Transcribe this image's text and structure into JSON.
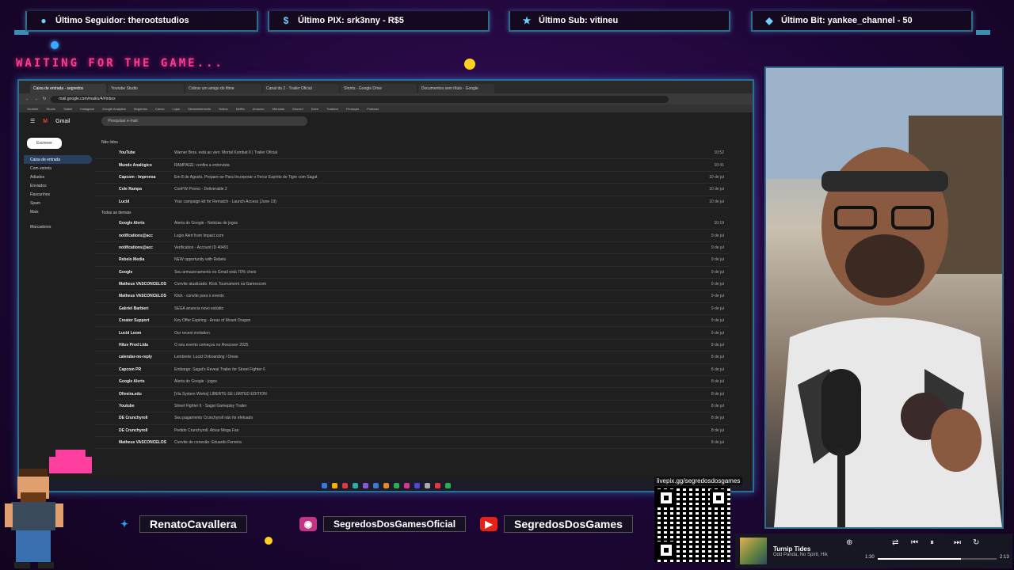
{
  "alerts": [
    {
      "icon": "user-icon",
      "label": "Último Seguidor: therootstudios"
    },
    {
      "icon": "dollar-icon",
      "label": "Último PIX: srk3nny - R$5"
    },
    {
      "icon": "star-icon",
      "label": "Último Sub: vitineu"
    },
    {
      "icon": "diamond-icon",
      "label": "Último Bit: yankee_channel - 50"
    }
  ],
  "waiting_text": "WAITING FOR THE GAME...",
  "browser": {
    "tabs": [
      "Caixa de entrada - segredos",
      "Youtube Studio",
      "Cobrar um amigo do filme",
      "Canal da 2 - Trailer Oficial",
      "Shorts - Google Drive",
      "Documentos sem título - Google"
    ],
    "url": "mail.google.com/mail/u/4/#inbox",
    "bookmarks": [
      "Youtube",
      "Studio",
      "Twitch",
      "Instagram",
      "Google Analytics",
      "Segredos",
      "Canva",
      "Lojas",
      "Streamelements",
      "Notion",
      "Netflix",
      "Amazon",
      "Mercado",
      "Discord",
      "Drive",
      "Tradutor",
      "Finanças",
      "Podcast"
    ],
    "gmail_label": "Gmail",
    "search_placeholder": "Pesquisar e-mail",
    "compose_label": "Escrever",
    "sidebar": [
      "Caixa de entrada",
      "Com estrela",
      "Adiados",
      "Enviados",
      "Rascunhos",
      "Spam",
      "Mais",
      "Marcadores"
    ],
    "section_unread": "Não lidos",
    "section_all": "Todas as demais",
    "unread": [
      {
        "sender": "YouTube",
        "subject": "Warner Bros. está ao vivo: Mortal Kombat II | Trailer Oficial",
        "date": "10:52"
      },
      {
        "sender": "Mundo Analógico",
        "subject": "RAMPAGE: confira a entrevista",
        "date": "10:41"
      },
      {
        "sender": "Capcom - Imprensa",
        "subject": "Em 8 de Agosto, Prepare-se Para Incorporar o Feroz Espírito do Tigre com Sagat",
        "date": "10 de jul"
      },
      {
        "sender": "Cole Rampa",
        "subject": "ConFW Promo - Deliverable 2",
        "date": "10 de jul"
      },
      {
        "sender": "Lucid",
        "subject": "Your campaign kit for Rematch - Launch Access (June 19)",
        "date": "10 de jul"
      }
    ],
    "all": [
      {
        "sender": "Google Alerts",
        "subject": "Alerta do Google - Noticias de jogos",
        "date": "10:19"
      },
      {
        "sender": "notifications@acc",
        "subject": "Login Alert from Impact.com",
        "date": "9 de jul"
      },
      {
        "sender": "notifications@acc",
        "subject": "Verification - Account ID 40491",
        "date": "9 de jul"
      },
      {
        "sender": "Rebelo Media",
        "subject": "NEW opportunity with Rebelo",
        "date": "9 de jul"
      },
      {
        "sender": "Google",
        "subject": "Seu armazenamento no Gmail está 70% cheio",
        "date": "9 de jul"
      },
      {
        "sender": "Matheus VASCONCELOS",
        "subject": "Convite atualizado: Klick Tournament na Gamescom",
        "date": "9 de jul"
      },
      {
        "sender": "Matheus VASCONCELOS",
        "subject": "Klick - convite para o evento",
        "date": "9 de jul"
      },
      {
        "sender": "Gabriel Barbieri",
        "subject": "SEGA anuncia novo estúdio",
        "date": "9 de jul"
      },
      {
        "sender": "Creator Support",
        "subject": "Key Offer Expiring - Areas of Mount Dragon",
        "date": "9 de jul"
      },
      {
        "sender": "Lucid Loom",
        "subject": "Our recent invitation",
        "date": "9 de jul"
      },
      {
        "sender": "Hiluv Prod Ltda",
        "subject": "O seu evento começou no Rescover 2025",
        "date": "8 de jul"
      },
      {
        "sender": "calendar-no-reply",
        "subject": "Lembrete: Lucid Onboarding / Onwe",
        "date": "8 de jul"
      },
      {
        "sender": "Capcom PR",
        "subject": "Embargo: Sagat's Reveal Trailer for Street Fighter 6",
        "date": "8 de jul"
      },
      {
        "sender": "Google Alerts",
        "subject": "Alerta do Google - jogos",
        "date": "8 de jul"
      },
      {
        "sender": "Oliveira.edu",
        "subject": "[Via System Works] LIBERTE-SE LIMITED EDITION",
        "date": "8 de jul"
      },
      {
        "sender": "Youtube",
        "subject": "Street Fighter 6 - Sagat Gameplay Trailer",
        "date": "8 de jul"
      },
      {
        "sender": "DE Crunchyroll",
        "subject": "Seu pagamento Crunchyroll não foi efetuado",
        "date": "8 de jul"
      },
      {
        "sender": "DE Crunchyroll",
        "subject": "Pedido Crunchyroll: Ativar Mega Fan",
        "date": "8 de jul"
      },
      {
        "sender": "Matheus VASCONCELOS",
        "subject": "Convite de conexão: Eduardo Ferreira",
        "date": "8 de jul"
      }
    ]
  },
  "social": [
    {
      "icon": "twitter-icon",
      "label": "RenatoCavallera",
      "color": "#1da1f2"
    },
    {
      "icon": "instagram-icon",
      "label": "SegredosDosGamesOficial",
      "color": "#c13584"
    },
    {
      "icon": "youtube-icon",
      "label": "SegredosDosGames",
      "color": "#e62117"
    }
  ],
  "qr_label": "livepix.gg/segredosdosgames",
  "player": {
    "title": "Turnip Tides",
    "artist": "Odd Panda, No Spirit, Hik",
    "elapsed": "1:30",
    "total": "2:13",
    "progress": 0.7
  }
}
